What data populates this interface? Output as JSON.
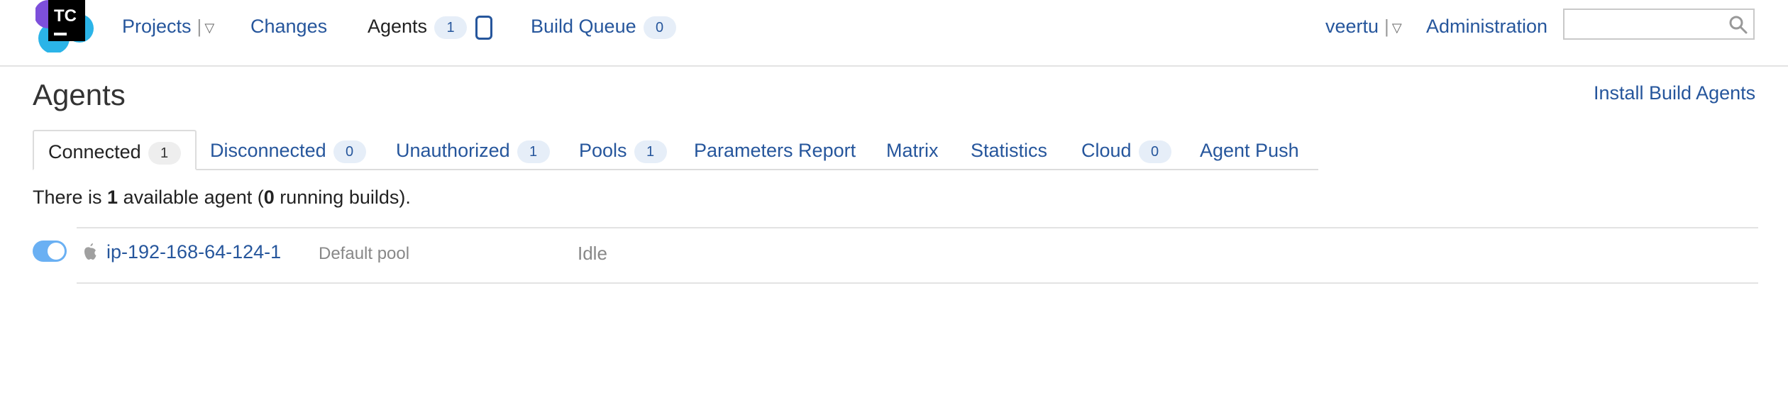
{
  "header": {
    "logo_text": "TC",
    "nav": {
      "projects": "Projects",
      "changes": "Changes",
      "agents": "Agents",
      "agents_count": "1",
      "build_queue": "Build Queue",
      "build_queue_count": "0"
    },
    "user": "veertu",
    "administration": "Administration",
    "search": {
      "value": "",
      "placeholder": ""
    }
  },
  "page": {
    "title": "Agents",
    "install_link": "Install Build Agents"
  },
  "tabs": [
    {
      "label": "Connected",
      "count": "1",
      "active": true
    },
    {
      "label": "Disconnected",
      "count": "0"
    },
    {
      "label": "Unauthorized",
      "count": "1"
    },
    {
      "label": "Pools",
      "count": "1"
    },
    {
      "label": "Parameters Report"
    },
    {
      "label": "Matrix"
    },
    {
      "label": "Statistics"
    },
    {
      "label": "Cloud",
      "count": "0"
    },
    {
      "label": "Agent Push"
    }
  ],
  "summary": {
    "prefix": "There is ",
    "available_count": "1",
    "middle": " available agent (",
    "running_count": "0",
    "suffix": " running builds)."
  },
  "agents": [
    {
      "name": "ip-192-168-64-124-1",
      "pool": "Default pool",
      "status": "Idle",
      "enabled": true,
      "os_icon": "apple-icon"
    }
  ],
  "colors": {
    "link": "#26569c",
    "toggle_on": "#6ab0f3",
    "counter_bg": "#e6eef8",
    "logo_bg": "#000000"
  }
}
